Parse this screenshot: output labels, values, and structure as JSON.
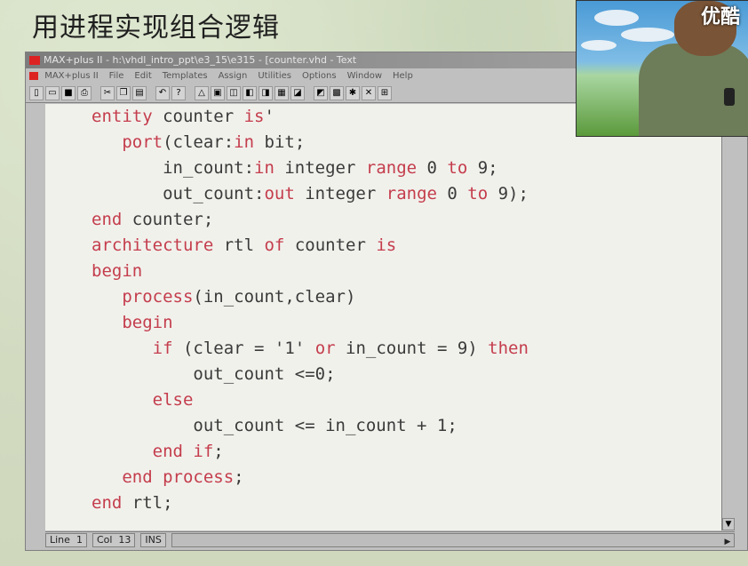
{
  "slide": {
    "title": "用进程实现组合逻辑"
  },
  "window": {
    "title": "MAX+plus II - h:\\vhdl_intro_ppt\\e3_15\\e315 - [counter.vhd - Text",
    "menu": [
      "MAX+plus II",
      "File",
      "Edit",
      "Templates",
      "Assign",
      "Utilities",
      "Options",
      "Window",
      "Help"
    ]
  },
  "toolbar": {
    "icons": [
      "new-file-icon",
      "open-file-icon",
      "save-icon",
      "print-icon",
      "cut-icon",
      "copy-icon",
      "paste-icon",
      "undo-icon",
      "help-icon",
      "hierarchy-icon",
      "compile-icon",
      "simulate-icon",
      "timing-icon",
      "program-icon",
      "floorplan-icon",
      "symbol-icon",
      "waveform-icon",
      "text-icon",
      "find-icon",
      "run-icon",
      "stop-icon"
    ]
  },
  "code": {
    "lines": [
      [
        {
          "t": "entity ",
          "k": true
        },
        {
          "t": "counter "
        },
        {
          "t": "is",
          "k": true
        },
        {
          "t": "'"
        }
      ],
      [
        {
          "t": "   "
        },
        {
          "t": "port",
          "k": true
        },
        {
          "t": "(clear:"
        },
        {
          "t": "in ",
          "k": true
        },
        {
          "t": "bit;"
        }
      ],
      [
        {
          "t": "       in_count:"
        },
        {
          "t": "in ",
          "k": true
        },
        {
          "t": "integer "
        },
        {
          "t": "range ",
          "k": true
        },
        {
          "t": "0 "
        },
        {
          "t": "to ",
          "k": true
        },
        {
          "t": "9;"
        }
      ],
      [
        {
          "t": "       out_count:"
        },
        {
          "t": "out ",
          "k": true
        },
        {
          "t": "integer "
        },
        {
          "t": "range ",
          "k": true
        },
        {
          "t": "0 "
        },
        {
          "t": "to ",
          "k": true
        },
        {
          "t": "9);"
        }
      ],
      [
        {
          "t": "end ",
          "k": true
        },
        {
          "t": "counter;"
        }
      ],
      [
        {
          "t": "architecture ",
          "k": true
        },
        {
          "t": "rtl "
        },
        {
          "t": "of ",
          "k": true
        },
        {
          "t": "counter "
        },
        {
          "t": "is",
          "k": true
        }
      ],
      [
        {
          "t": "begin",
          "k": true
        }
      ],
      [
        {
          "t": "   "
        },
        {
          "t": "process",
          "k": true
        },
        {
          "t": "(in_count,clear)"
        }
      ],
      [
        {
          "t": "   "
        },
        {
          "t": "begin",
          "k": true
        }
      ],
      [
        {
          "t": "      "
        },
        {
          "t": "if ",
          "k": true
        },
        {
          "t": "(clear = '1' "
        },
        {
          "t": "or ",
          "k": true
        },
        {
          "t": "in_count = 9) "
        },
        {
          "t": "then",
          "k": true
        }
      ],
      [
        {
          "t": "          out_count <=0;"
        }
      ],
      [
        {
          "t": "      "
        },
        {
          "t": "else",
          "k": true
        }
      ],
      [
        {
          "t": "          out_count <= in_count + 1;"
        }
      ],
      [
        {
          "t": "      "
        },
        {
          "t": "end if",
          "k": true
        },
        {
          "t": ";"
        }
      ],
      [
        {
          "t": "   "
        },
        {
          "t": "end process",
          "k": true
        },
        {
          "t": ";"
        }
      ],
      [
        {
          "t": "end ",
          "k": true
        },
        {
          "t": "rtl;"
        }
      ]
    ]
  },
  "status": {
    "line_label": "Line",
    "line_value": "1",
    "col_label": "Col",
    "col_value": "13",
    "mode": "INS"
  },
  "webcam": {
    "watermark": "优酷"
  }
}
